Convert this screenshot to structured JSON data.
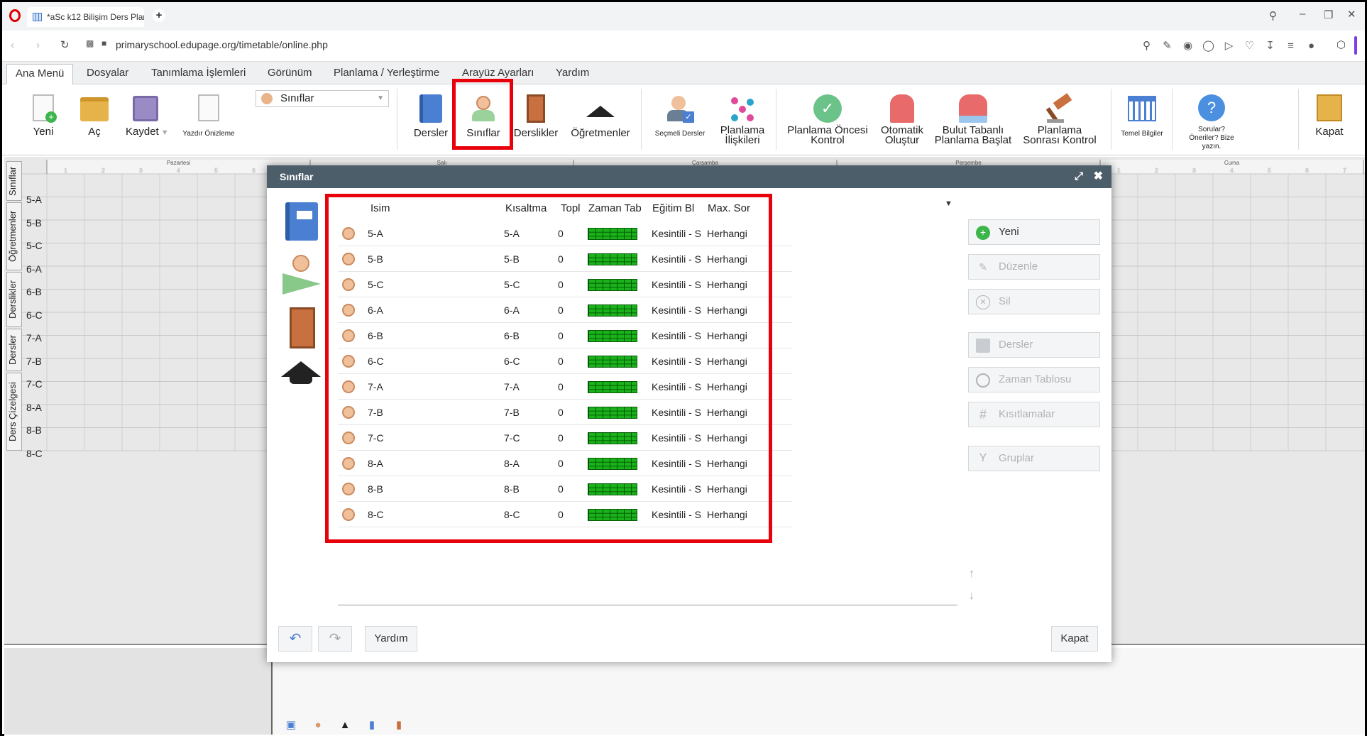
{
  "browser": {
    "tab_title": "*aSc k12 Bilişim Ders Plan",
    "url": "primaryschool.edupage.org/timetable/online.php"
  },
  "menu": [
    "Ana Menü",
    "Dosyalar",
    "Tanımlama İşlemleri",
    "Görünüm",
    "Planlama / Yerleştirme",
    "Arayüz Ayarları",
    "Yardım"
  ],
  "ribbon": {
    "new": "Yeni",
    "open": "Aç",
    "save": "Kaydet",
    "print_preview": "Yazdır Önizleme",
    "view_select": "Sınıflar",
    "subjects": "Dersler",
    "classes": "Sınıflar",
    "classrooms": "Derslikler",
    "teachers": "Öğretmenler",
    "elective": "Seçmeli Dersler",
    "relations_1": "Planlama",
    "relations_2": "İlişkileri",
    "pre_check_1": "Planlama Öncesi",
    "pre_check_2": "Kontrol",
    "auto_1": "Otomatik",
    "auto_2": "Oluştur",
    "cloud_1": "Bulut Tabanlı",
    "cloud_2": "Planlama Başlat",
    "post_check_1": "Planlama",
    "post_check_2": "Sonrası Kontrol",
    "basic_info": "Temel Bilgiler",
    "questions_1": "Sorular?",
    "questions_2": "Öneriler? Bize",
    "questions_3": "yazın.",
    "close": "Kapat"
  },
  "timetable": {
    "days": [
      "Pazartesi",
      "Salı",
      "Çarşamba",
      "Perşembe",
      "Cuma"
    ],
    "periods": [
      "1",
      "2",
      "3",
      "4",
      "5",
      "6",
      "7"
    ],
    "side_tabs": [
      "Sınıflar",
      "Öğretmenler",
      "Derslikler",
      "Dersler",
      "Ders Çizelgesi"
    ],
    "rows": [
      "5-A",
      "5-B",
      "5-C",
      "6-A",
      "6-B",
      "6-C",
      "7-A",
      "7-B",
      "7-C",
      "8-A",
      "8-B",
      "8-C"
    ]
  },
  "dialog": {
    "title": "Sınıflar",
    "columns": [
      "Isim",
      "Kısaltma",
      "Topl",
      "Zaman Tab",
      "Eğitim Bl",
      "Max. Sor"
    ],
    "rows": [
      {
        "name": "5-A",
        "short": "5-A",
        "total": "0",
        "edu": "Kesintili - S",
        "max": "Herhangi"
      },
      {
        "name": "5-B",
        "short": "5-B",
        "total": "0",
        "edu": "Kesintili - S",
        "max": "Herhangi"
      },
      {
        "name": "5-C",
        "short": "5-C",
        "total": "0",
        "edu": "Kesintili - S",
        "max": "Herhangi"
      },
      {
        "name": "6-A",
        "short": "6-A",
        "total": "0",
        "edu": "Kesintili - S",
        "max": "Herhangi"
      },
      {
        "name": "6-B",
        "short": "6-B",
        "total": "0",
        "edu": "Kesintili - S",
        "max": "Herhangi"
      },
      {
        "name": "6-C",
        "short": "6-C",
        "total": "0",
        "edu": "Kesintili - S",
        "max": "Herhangi"
      },
      {
        "name": "7-A",
        "short": "7-A",
        "total": "0",
        "edu": "Kesintili - S",
        "max": "Herhangi"
      },
      {
        "name": "7-B",
        "short": "7-B",
        "total": "0",
        "edu": "Kesintili - S",
        "max": "Herhangi"
      },
      {
        "name": "7-C",
        "short": "7-C",
        "total": "0",
        "edu": "Kesintili - S",
        "max": "Herhangi"
      },
      {
        "name": "8-A",
        "short": "8-A",
        "total": "0",
        "edu": "Kesintili - S",
        "max": "Herhangi"
      },
      {
        "name": "8-B",
        "short": "8-B",
        "total": "0",
        "edu": "Kesintili - S",
        "max": "Herhangi"
      },
      {
        "name": "8-C",
        "short": "8-C",
        "total": "0",
        "edu": "Kesintili - S",
        "max": "Herhangi"
      }
    ],
    "buttons": {
      "new": "Yeni",
      "edit": "Düzenle",
      "delete": "Sil",
      "subjects": "Dersler",
      "timetable": "Zaman Tablosu",
      "constraints": "Kısıtlamalar",
      "groups": "Gruplar"
    },
    "footer": {
      "help": "Yardım",
      "close": "Kapat"
    }
  },
  "colors": {
    "highlight": "#e8000b",
    "dialog_header": "#4d5e6b",
    "availability": "#1ab21a"
  }
}
